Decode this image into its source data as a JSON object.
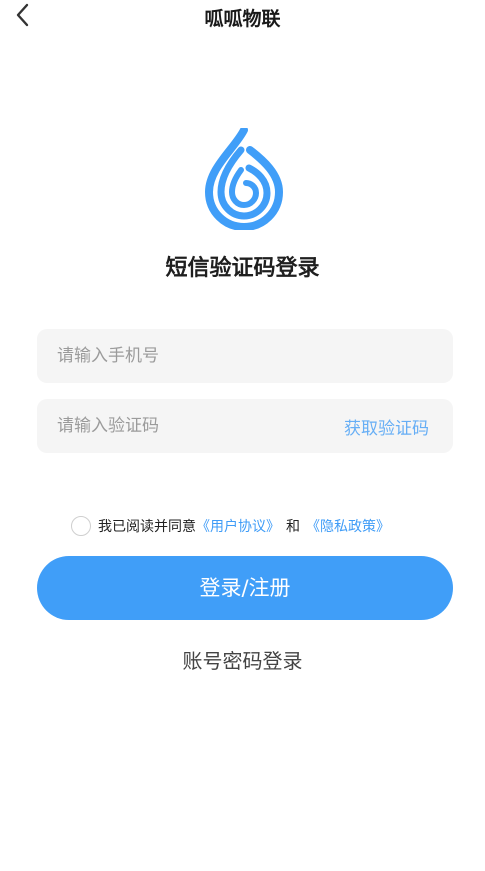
{
  "header": {
    "title": "呱呱物联",
    "back_icon": "chevron-left-icon"
  },
  "logo": {
    "icon": "water-drop-logo",
    "color": "#409ef8"
  },
  "subtitle": "短信验证码登录",
  "phone_field": {
    "placeholder": "请输入手机号",
    "value": ""
  },
  "code_field": {
    "placeholder": "请输入验证码",
    "value": "",
    "get_code_label": "获取验证码"
  },
  "agreement": {
    "prefix": "我已阅读并同意",
    "user_agreement": "《用户协议》",
    "and": "和",
    "privacy_policy": "《隐私政策》",
    "checked": false
  },
  "login_button": {
    "label": "登录/注册",
    "color": "#409ef8"
  },
  "password_login": "账号密码登录"
}
